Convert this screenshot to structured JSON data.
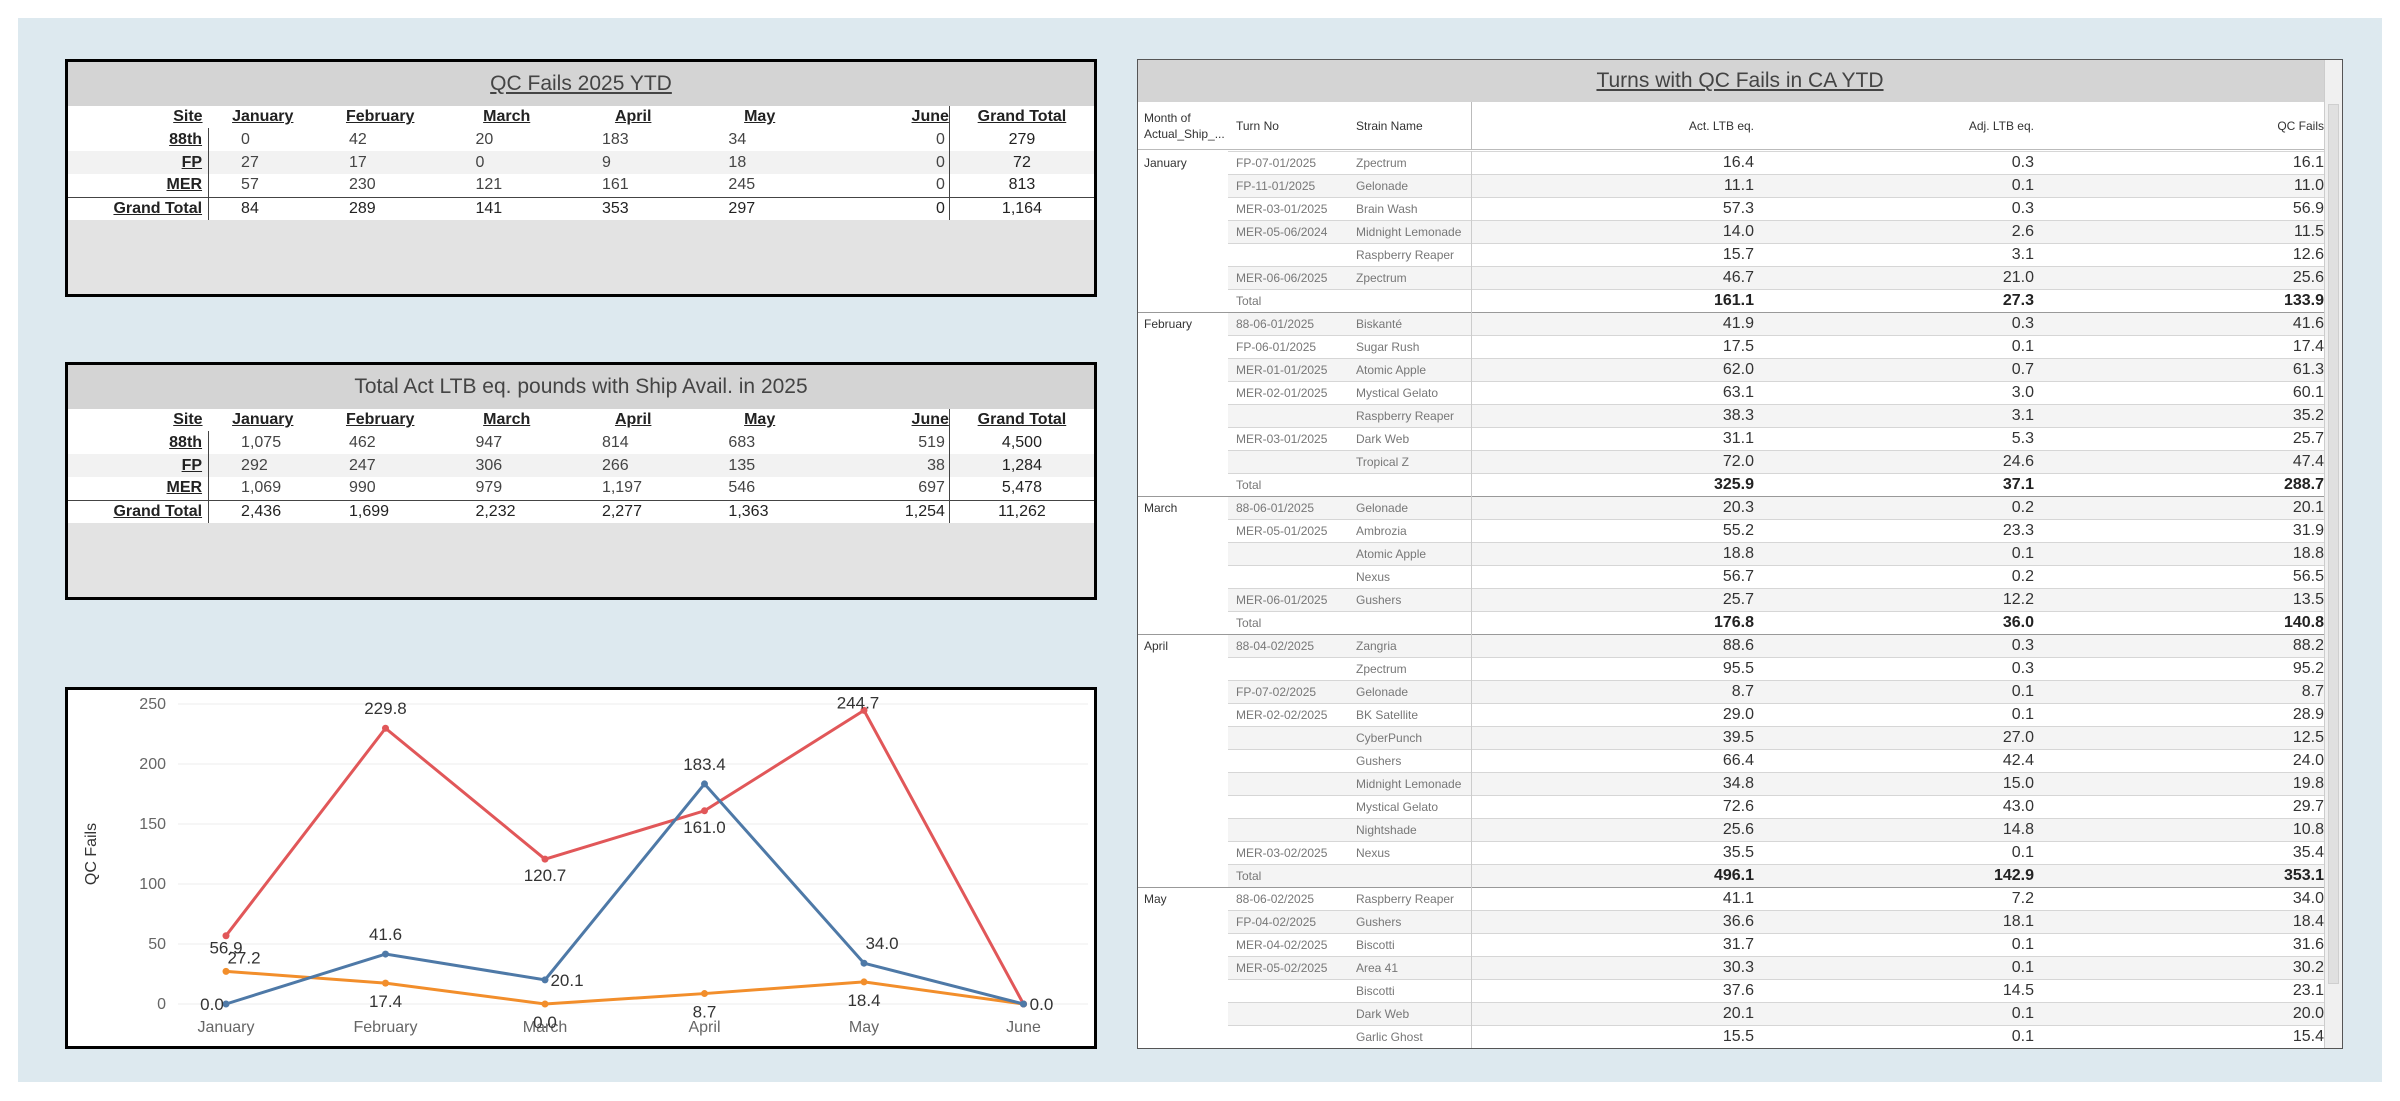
{
  "qc_fails_table": {
    "title": "QC Fails 2025 YTD",
    "columns": [
      "Site",
      "January",
      "February",
      "March",
      "April",
      "May",
      "June",
      "Grand Total"
    ],
    "rows": [
      {
        "site": "88th",
        "values": [
          "0",
          "42",
          "20",
          "183",
          "34",
          "0"
        ],
        "total": "279"
      },
      {
        "site": "FP",
        "values": [
          "27",
          "17",
          "0",
          "9",
          "18",
          "0"
        ],
        "total": "72"
      },
      {
        "site": "MER",
        "values": [
          "57",
          "230",
          "121",
          "161",
          "245",
          "0"
        ],
        "total": "813"
      },
      {
        "site": "Grand Total",
        "values": [
          "84",
          "289",
          "141",
          "353",
          "297",
          "0"
        ],
        "total": "1,164"
      }
    ]
  },
  "ltb_table": {
    "title": "Total Act LTB eq. pounds with Ship Avail. in 2025",
    "columns": [
      "Site",
      "January",
      "February",
      "March",
      "April",
      "May",
      "June",
      "Grand Total"
    ],
    "rows": [
      {
        "site": "88th",
        "values": [
          "1,075",
          "462",
          "947",
          "814",
          "683",
          "519"
        ],
        "total": "4,500"
      },
      {
        "site": "FP",
        "values": [
          "292",
          "247",
          "306",
          "266",
          "135",
          "38"
        ],
        "total": "1,284"
      },
      {
        "site": "MER",
        "values": [
          "1,069",
          "990",
          "979",
          "1,197",
          "546",
          "697"
        ],
        "total": "5,478"
      },
      {
        "site": "Grand Total",
        "values": [
          "2,436",
          "1,699",
          "2,232",
          "2,277",
          "1,363",
          "1,254"
        ],
        "total": "11,262"
      }
    ]
  },
  "chart_data": {
    "type": "line",
    "title": "",
    "xlabel": "",
    "ylabel": "QC Fails",
    "categories": [
      "January",
      "February",
      "March",
      "April",
      "May",
      "June"
    ],
    "ylim": [
      0,
      250
    ],
    "yticks": [
      "0",
      "50",
      "100",
      "150",
      "200",
      "250"
    ],
    "grid": true,
    "series": [
      {
        "color": "#e15759",
        "values": [
          56.9,
          229.8,
          120.7,
          161.0,
          244.7,
          0.0
        ],
        "labels": [
          "56.9",
          "229.8",
          "120.7",
          "161.0",
          "244.7",
          ""
        ]
      },
      {
        "color": "#4e79a7",
        "values": [
          0.0,
          41.6,
          20.1,
          183.4,
          34.0,
          0.0
        ],
        "labels": [
          "0.0",
          "41.6",
          "20.1",
          "183.4",
          "34.0",
          "0.0"
        ]
      },
      {
        "color": "#f28e2b",
        "values": [
          27.2,
          17.4,
          0.0,
          8.7,
          18.4,
          0.0
        ],
        "labels": [
          "27.2",
          "17.4",
          "0.0",
          "8.7",
          "18.4",
          ""
        ]
      }
    ]
  },
  "turns_table": {
    "title": "Turns with QC Fails in CA YTD",
    "headers": {
      "month": "Month of Actual_Ship_...",
      "turn": "Turn No",
      "strain": "Strain Name",
      "act": "Act. LTB eq.",
      "adj": "Adj. LTB eq.",
      "qc": "QC Fails"
    },
    "rows": [
      {
        "month": "January",
        "turn": "FP-07-01/2025",
        "strain": "Zpectrum",
        "act": "16.4",
        "adj": "0.3",
        "qc": "16.1"
      },
      {
        "month": "",
        "turn": "FP-11-01/2025",
        "strain": "Gelonade",
        "act": "11.1",
        "adj": "0.1",
        "qc": "11.0"
      },
      {
        "month": "",
        "turn": "MER-03-01/2025",
        "strain": "Brain Wash",
        "act": "57.3",
        "adj": "0.3",
        "qc": "56.9"
      },
      {
        "month": "",
        "turn": "MER-05-06/2024",
        "strain": "Midnight Lemonade",
        "act": "14.0",
        "adj": "2.6",
        "qc": "11.5"
      },
      {
        "month": "",
        "turn": "",
        "strain": "Raspberry Reaper",
        "act": "15.7",
        "adj": "3.1",
        "qc": "12.6"
      },
      {
        "month": "",
        "turn": "MER-06-06/2025",
        "strain": "Zpectrum",
        "act": "46.7",
        "adj": "21.0",
        "qc": "25.6"
      },
      {
        "month": "",
        "turn": "Total",
        "strain": "",
        "act": "161.1",
        "adj": "27.3",
        "qc": "133.9",
        "total": true
      },
      {
        "month": "February",
        "turn": "88-06-01/2025",
        "strain": "Biskanté",
        "act": "41.9",
        "adj": "0.3",
        "qc": "41.6"
      },
      {
        "month": "",
        "turn": "FP-06-01/2025",
        "strain": "Sugar Rush",
        "act": "17.5",
        "adj": "0.1",
        "qc": "17.4"
      },
      {
        "month": "",
        "turn": "MER-01-01/2025",
        "strain": "Atomic Apple",
        "act": "62.0",
        "adj": "0.7",
        "qc": "61.3"
      },
      {
        "month": "",
        "turn": "MER-02-01/2025",
        "strain": "Mystical Gelato",
        "act": "63.1",
        "adj": "3.0",
        "qc": "60.1"
      },
      {
        "month": "",
        "turn": "",
        "strain": "Raspberry Reaper",
        "act": "38.3",
        "adj": "3.1",
        "qc": "35.2"
      },
      {
        "month": "",
        "turn": "MER-03-01/2025",
        "strain": "Dark Web",
        "act": "31.1",
        "adj": "5.3",
        "qc": "25.7"
      },
      {
        "month": "",
        "turn": "",
        "strain": "Tropical Z",
        "act": "72.0",
        "adj": "24.6",
        "qc": "47.4"
      },
      {
        "month": "",
        "turn": "Total",
        "strain": "",
        "act": "325.9",
        "adj": "37.1",
        "qc": "288.7",
        "total": true
      },
      {
        "month": "March",
        "turn": "88-06-01/2025",
        "strain": "Gelonade",
        "act": "20.3",
        "adj": "0.2",
        "qc": "20.1"
      },
      {
        "month": "",
        "turn": "MER-05-01/2025",
        "strain": "Ambrozia",
        "act": "55.2",
        "adj": "23.3",
        "qc": "31.9"
      },
      {
        "month": "",
        "turn": "",
        "strain": "Atomic Apple",
        "act": "18.8",
        "adj": "0.1",
        "qc": "18.8"
      },
      {
        "month": "",
        "turn": "",
        "strain": "Nexus",
        "act": "56.7",
        "adj": "0.2",
        "qc": "56.5"
      },
      {
        "month": "",
        "turn": "MER-06-01/2025",
        "strain": "Gushers",
        "act": "25.7",
        "adj": "12.2",
        "qc": "13.5"
      },
      {
        "month": "",
        "turn": "Total",
        "strain": "",
        "act": "176.8",
        "adj": "36.0",
        "qc": "140.8",
        "total": true
      },
      {
        "month": "April",
        "turn": "88-04-02/2025",
        "strain": "Zangria",
        "act": "88.6",
        "adj": "0.3",
        "qc": "88.2"
      },
      {
        "month": "",
        "turn": "",
        "strain": "Zpectrum",
        "act": "95.5",
        "adj": "0.3",
        "qc": "95.2"
      },
      {
        "month": "",
        "turn": "FP-07-02/2025",
        "strain": "Gelonade",
        "act": "8.7",
        "adj": "0.1",
        "qc": "8.7"
      },
      {
        "month": "",
        "turn": "MER-02-02/2025",
        "strain": "BK Satellite",
        "act": "29.0",
        "adj": "0.1",
        "qc": "28.9"
      },
      {
        "month": "",
        "turn": "",
        "strain": "CyberPunch",
        "act": "39.5",
        "adj": "27.0",
        "qc": "12.5"
      },
      {
        "month": "",
        "turn": "",
        "strain": "Gushers",
        "act": "66.4",
        "adj": "42.4",
        "qc": "24.0"
      },
      {
        "month": "",
        "turn": "",
        "strain": "Midnight Lemonade",
        "act": "34.8",
        "adj": "15.0",
        "qc": "19.8"
      },
      {
        "month": "",
        "turn": "",
        "strain": "Mystical Gelato",
        "act": "72.6",
        "adj": "43.0",
        "qc": "29.7"
      },
      {
        "month": "",
        "turn": "",
        "strain": "Nightshade",
        "act": "25.6",
        "adj": "14.8",
        "qc": "10.8"
      },
      {
        "month": "",
        "turn": "MER-03-02/2025",
        "strain": "Nexus",
        "act": "35.5",
        "adj": "0.1",
        "qc": "35.4"
      },
      {
        "month": "",
        "turn": "Total",
        "strain": "",
        "act": "496.1",
        "adj": "142.9",
        "qc": "353.1",
        "total": true
      },
      {
        "month": "May",
        "turn": "88-06-02/2025",
        "strain": "Raspberry Reaper",
        "act": "41.1",
        "adj": "7.2",
        "qc": "34.0"
      },
      {
        "month": "",
        "turn": "FP-04-02/2025",
        "strain": "Gushers",
        "act": "36.6",
        "adj": "18.1",
        "qc": "18.4"
      },
      {
        "month": "",
        "turn": "MER-04-02/2025",
        "strain": "Biscotti",
        "act": "31.7",
        "adj": "0.1",
        "qc": "31.6"
      },
      {
        "month": "",
        "turn": "MER-05-02/2025",
        "strain": "Area 41",
        "act": "30.3",
        "adj": "0.1",
        "qc": "30.2"
      },
      {
        "month": "",
        "turn": "",
        "strain": "Biscotti",
        "act": "37.6",
        "adj": "14.5",
        "qc": "23.1"
      },
      {
        "month": "",
        "turn": "",
        "strain": "Dark Web",
        "act": "20.1",
        "adj": "0.1",
        "qc": "20.0"
      },
      {
        "month": "",
        "turn": "",
        "strain": "Garlic Ghost",
        "act": "15.5",
        "adj": "0.1",
        "qc": "15.4"
      }
    ]
  }
}
